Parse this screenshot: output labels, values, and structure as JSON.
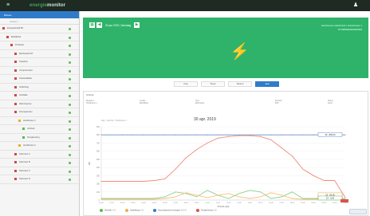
{
  "topbar": {
    "logo_a": "energie",
    "logo_b": "monitor"
  },
  "sidebar": {
    "header": "Beheer",
    "search": "Zoeken...",
    "items": [
      {
        "label": "Energiebedrijf BV",
        "indent": 3,
        "kind": "red"
      },
      {
        "label": "Bedrijfshal",
        "indent": 8,
        "kind": "red"
      },
      {
        "label": "Productie",
        "indent": 13,
        "kind": "red"
      },
      {
        "label": "Machinehal NT",
        "indent": 18,
        "kind": "red"
      },
      {
        "label": "Ketelhuis",
        "indent": 18,
        "kind": "red"
      },
      {
        "label": "Compressoren",
        "indent": 18,
        "kind": "red"
      },
      {
        "label": "Koelinstallatie",
        "indent": 18,
        "kind": "red"
      },
      {
        "label": "Verlichting",
        "indent": 18,
        "kind": "red"
      },
      {
        "label": "Ventilatie",
        "indent": 18,
        "kind": "red"
      },
      {
        "label": "Warmtepomp",
        "indent": 18,
        "kind": "red"
      },
      {
        "label": "Zonnepanelen",
        "indent": 18,
        "kind": "red"
      },
      {
        "label": "Hoofdmeter 1",
        "indent": 23,
        "kind": "yel"
      },
      {
        "label": "Verbruik",
        "indent": 28,
        "kind": "grn"
      },
      {
        "label": "Teruglevering",
        "indent": 28,
        "kind": "grn"
      },
      {
        "label": "Hoofdmeter 2",
        "indent": 23,
        "kind": "yel"
      },
      {
        "label": "Submeter A",
        "indent": 18,
        "kind": "red"
      },
      {
        "label": "Submeter B",
        "indent": 18,
        "kind": "red"
      },
      {
        "label": "Submeter C",
        "indent": 18,
        "kind": "red"
      },
      {
        "label": "Submeter D",
        "indent": 18,
        "kind": "red"
      }
    ]
  },
  "banner": {
    "prev": "◀",
    "next": "▶",
    "cal": "▦",
    "date": "30 apr 2019 | Vandaag",
    "info_line1": "Hoofdmeter elektriciteit | Hoofdmeter 1",
    "info_line2": "871685900000000000"
  },
  "tabs": [
    "Dag",
    "Week",
    "Maand",
    "Jaar"
  ],
  "active_tab": 3,
  "panel": {
    "title": "Verbruik",
    "meta": [
      {
        "k": "Meetpunt",
        "v": "Hoofdmeter 1"
      },
      {
        "k": "Locatie",
        "v": "Bedrijfshal"
      },
      {
        "k": "Type",
        "v": "Elektriciteit"
      },
      {
        "k": "Eenheid",
        "v": "kWh"
      },
      {
        "k": "Status",
        "v": "Actief"
      }
    ],
    "chart_title": "30 apr. 2019",
    "crumb": "Dag > Verbruik > Hoofdmeter 1"
  },
  "chart_data": {
    "type": "line",
    "title": "30 apr. 2019",
    "xlabel": "Periode (tijd)",
    "ylabel": "kW",
    "x": [
      "00:00",
      "01:00",
      "02:00",
      "03:00",
      "04:00",
      "05:00",
      "06:00",
      "07:00",
      "08:00",
      "09:00",
      "10:00",
      "11:00",
      "12:00",
      "13:00",
      "14:00",
      "15:00",
      "16:00",
      "17:00",
      "18:00",
      "19:00",
      "20:00",
      "21:00",
      "22:00",
      "23:00"
    ],
    "ylim": [
      0,
      900
    ],
    "series": [
      {
        "name": "Verbruik",
        "color": "#f08a7a",
        "values": [
          230,
          230,
          230,
          230,
          230,
          240,
          260,
          380,
          520,
          620,
          700,
          760,
          780,
          790,
          790,
          780,
          740,
          640,
          540,
          380,
          300,
          240,
          240,
          30
        ]
      },
      {
        "name": "Teruglevering",
        "color": "#8fd18a",
        "values": [
          20,
          20,
          20,
          20,
          20,
          20,
          40,
          100,
          80,
          40,
          120,
          60,
          20,
          80,
          120,
          100,
          20,
          40,
          100,
          20,
          20,
          20,
          20,
          20
        ]
      },
      {
        "name": "Opwekking",
        "color": "#f7c07a",
        "values": [
          10,
          10,
          10,
          10,
          10,
          10,
          20,
          40,
          90,
          60,
          30,
          60,
          80,
          40,
          20,
          40,
          90,
          60,
          20,
          10,
          10,
          10,
          10,
          10
        ]
      },
      {
        "name": "Gecontracteerd vermogen",
        "color": "#6b8ec6",
        "values": [
          800,
          800,
          800,
          800,
          800,
          800,
          800,
          800,
          800,
          800,
          800,
          800,
          800,
          800,
          800,
          800,
          800,
          800,
          800,
          800,
          800,
          800,
          800,
          800
        ]
      }
    ],
    "flags": [
      {
        "label": "29 - 800,00",
        "color": "#6b8ec6"
      },
      {
        "label": "23 - 0,00",
        "color": "#d9534f"
      },
      {
        "label": "23 - 65,00",
        "color": "#f0ad4e"
      },
      {
        "label": "23 - 0,00",
        "color": "#5cb85c"
      }
    ],
    "legend": [
      {
        "name": "Verbruik",
        "color": "#5cb85c",
        "value": "0,00"
      },
      {
        "name": "Opwekking",
        "color": "#f0ad4e",
        "value": "0,00"
      },
      {
        "name": "Gecontracteerd vermogen",
        "color": "#2f7bc9",
        "value": "800,00"
      },
      {
        "name": "Teruglevering",
        "color": "#d9534f",
        "value": "0,00"
      }
    ]
  }
}
